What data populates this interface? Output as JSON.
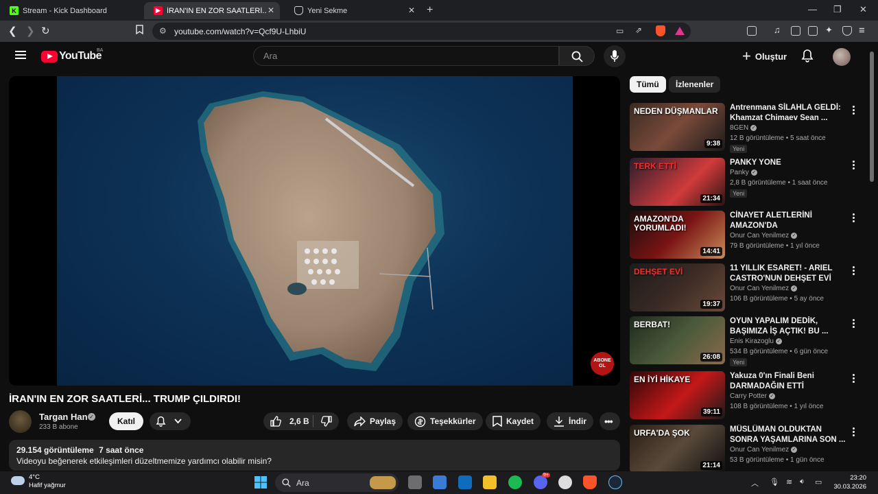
{
  "browser": {
    "tabs": [
      {
        "title": "Stream - Kick Dashboard",
        "active": false
      },
      {
        "title": "İRAN'IN EN ZOR SAATLERİ... TRU",
        "active": true
      },
      {
        "title": "Yeni Sekme",
        "active": false
      }
    ],
    "url": "youtube.com/watch?v=Qcf9U-LhbiU",
    "extension_badge": "20"
  },
  "youtube": {
    "logo_text": "YouTube",
    "country_code": "BA",
    "search_placeholder": "Ara",
    "create_label": "Oluştur"
  },
  "video": {
    "title": "İRAN'IN EN ZOR SAATLERİ... TRUMP ÇILDIRDI!",
    "overlay_badge": "ABONE OL",
    "channel": {
      "name": "Targan Han",
      "subscribers": "233 B abone"
    },
    "join_label": "Katıl",
    "actions": {
      "likes": "2,6 B",
      "share": "Paylaş",
      "thanks": "Teşekkürler",
      "save": "Kaydet",
      "download": "İndir"
    },
    "description": {
      "views": "29.154 görüntüleme",
      "age": "7 saat önce",
      "text": "Videoyu beğenerek etkileşimleri düzeltmemize yardımcı olabilir misin?"
    }
  },
  "sidebar": {
    "chips": [
      "Tümü",
      "İzlenenler"
    ],
    "recommendations": [
      {
        "title": "Antrenmana SİLAHLA GELDİ: Khamzat Chimaev Sean ...",
        "channel": "8GEN",
        "verified": true,
        "views": "12 B görüntüleme",
        "age": "5 saat önce",
        "new": "Yeni",
        "duration": "9:38",
        "thumb_text": "NEDEN DÜŞMANLAR"
      },
      {
        "title": "PANKY YONE",
        "channel": "Panky",
        "verified": true,
        "views": "2,8 B görüntüleme",
        "age": "1 saat önce",
        "new": "Yeni",
        "duration": "21:34",
        "thumb_text": "TERK ETTİ"
      },
      {
        "title": "CİNAYET ALETLERİNİ AMAZON'DA YORUMLUYORD...",
        "channel": "Onur Can Yenilmez",
        "verified": true,
        "views": "79 B görüntüleme",
        "age": "1 yıl önce",
        "new": "",
        "duration": "14:41",
        "thumb_text": "AMAZON'DA YORUMLADI!"
      },
      {
        "title": "11 YILLIK ESARET! - ARIEL CASTRO'NUN DEHŞET EVİ",
        "channel": "Onur Can Yenilmez",
        "verified": true,
        "views": "106 B görüntüleme",
        "age": "5 ay önce",
        "new": "",
        "duration": "19:37",
        "thumb_text": "DEHŞET EVİ"
      },
      {
        "title": "OYUN YAPALIM DEDİK, BAŞIMIZA İŞ AÇTIK! BU ...",
        "channel": "Enis Kirazoglu",
        "verified": true,
        "views": "534 B görüntüleme",
        "age": "6 gün önce",
        "new": "Yeni",
        "duration": "26:08",
        "thumb_text": "BERBAT!"
      },
      {
        "title": "Yakuza 0'ın Finali Beni DARMADAĞIN ETTİ",
        "channel": "Carry Potter",
        "verified": true,
        "views": "108 B görüntüleme",
        "age": "1 yıl önce",
        "new": "",
        "duration": "39:11",
        "thumb_text": "EN İYİ HİKAYE"
      },
      {
        "title": "MÜSLÜMAN OLDUKTAN SONRA YAŞAMLARINA SON ...",
        "channel": "Onur Can Yenilmez",
        "verified": true,
        "views": "53 B görüntüleme",
        "age": "1 gün önce",
        "new": "",
        "duration": "21:14",
        "thumb_text": "URFA'DA ŞOK"
      }
    ]
  },
  "taskbar": {
    "temperature": "4°C",
    "weather": "Hafif yağmur",
    "search_label": "Ara",
    "time": "23:20",
    "date": "30.03.2026",
    "discord_badge": "9+"
  }
}
